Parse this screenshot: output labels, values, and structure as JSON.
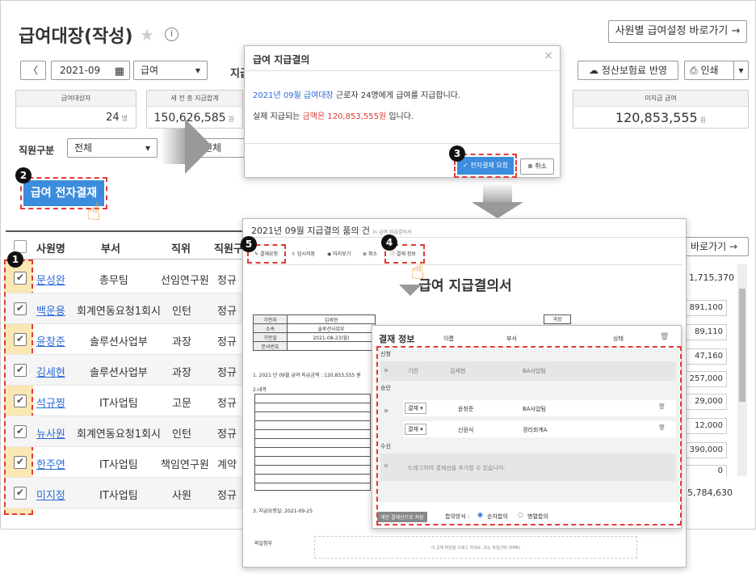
{
  "page": {
    "title": "급여대장(작성)",
    "shortcut": "사원별 급여설정 바로가기 →"
  },
  "toolbar": {
    "prev": "〈",
    "month": "2021-09",
    "type": "급여",
    "pay_label": "지급",
    "insurance": "정산보험료 반영",
    "print": "인쇄"
  },
  "cards": [
    {
      "label": "급여대상자",
      "value": "24",
      "unit": "명"
    },
    {
      "label": "세 전 총 지급합계",
      "value": "150,626,585",
      "unit": "원"
    },
    {
      "label": "미지급 급여",
      "value": "120,853,555",
      "unit": "원"
    }
  ],
  "filters": {
    "emp_type_label": "직원구분",
    "emp_type_value": "전체",
    "position_label": "직위",
    "position_value": "전체"
  },
  "approve_button": "급여 전자결재",
  "table": {
    "headers": [
      "사원명",
      "부서",
      "직위",
      "직원구"
    ],
    "rows": [
      {
        "name": "문성완",
        "dept": "총무팀",
        "pos": "선임연구원",
        "type": "정규",
        "amount": "1,715,370"
      },
      {
        "name": "백운용",
        "dept": "회계연동요청1회시",
        "pos": "인턴",
        "type": "정규",
        "amount": "891,100"
      },
      {
        "name": "윤창준",
        "dept": "솔루션사업부",
        "pos": "과장",
        "type": "정규",
        "amount": "89,110"
      },
      {
        "name": "김세현",
        "dept": "솔루션사업부",
        "pos": "과장",
        "type": "정규",
        "amount": "47,160"
      },
      {
        "name": "석규찡",
        "dept": "IT사업팀",
        "pos": "고문",
        "type": "정규",
        "amount": "257,000"
      },
      {
        "name": "뉴사원",
        "dept": "회계연동요청1회시",
        "pos": "인턴",
        "type": "정규",
        "amount": "29,000"
      },
      {
        "name": "한주연",
        "dept": "IT사업팀",
        "pos": "책임연구원",
        "type": "계약",
        "amount": "12,000"
      },
      {
        "name": "미지정",
        "dept": "IT사업팀",
        "pos": "사원",
        "type": "정규",
        "amount": "390,000"
      }
    ],
    "extra_amount": "0",
    "total": "5,784,630",
    "shortcut2": "바로가기 →"
  },
  "modal": {
    "title": "급여 지급결의",
    "line1_prefix": "2021년 09월 급여대장",
    "line1_suffix": " 근로자 24명에게 급여를 지급합니다.",
    "line2_prefix": "실제 지급되는 ",
    "line2_amount": "금액은 120,853,555원",
    "line2_suffix": " 입니다.",
    "request": "전자결재 요청",
    "cancel": "취소"
  },
  "doc": {
    "header": "2021년 09월 지급결의 품의 건",
    "header_sub": "in 급여 지급결의서",
    "actions": [
      "결재요청",
      "임시저장",
      "미리보기",
      "취소",
      "결재 정보"
    ],
    "title": "급여 지급결의서",
    "table": [
      [
        "기안자",
        "김세현"
      ],
      [
        "소속",
        "솔루션사업부"
      ],
      [
        "기안일",
        "2021-08-23(월)"
      ],
      [
        "문서번호",
        ""
      ]
    ],
    "approval_cell": "과장",
    "line1": "1. 2021 년 09월 급여 지급금액 : 120,853,555 원",
    "line2": "2.내역",
    "line3": "3. 지급요청일: 2021-09-25",
    "attach_label": "파일첨부",
    "attach_text": "이 곳에 파일을 드래그 하세요. 또는 파일선택 (0MB)"
  },
  "panel": {
    "title": "결재 정보",
    "cols": [
      "이름",
      "부서",
      "상태"
    ],
    "sec1": "신청",
    "req_row": {
      "type": "기안",
      "name": "김세현",
      "dept": "BA사업팀"
    },
    "sec2": "승인",
    "approvers": [
      {
        "type": "결재",
        "name": "윤창준",
        "dept": "BA사업팀"
      },
      {
        "type": "결재",
        "name": "신원식",
        "dept": "경리회계A"
      }
    ],
    "sec3": "수신",
    "drag_text": "드래그하여 결재선을 추가할 수 있습니다.",
    "save_line": "개인 결재선으로 저장",
    "method_label": "합의방식 :",
    "method1": "순차합의",
    "method2": "병렬합의"
  },
  "badges": [
    "1",
    "2",
    "3",
    "4",
    "5"
  ]
}
